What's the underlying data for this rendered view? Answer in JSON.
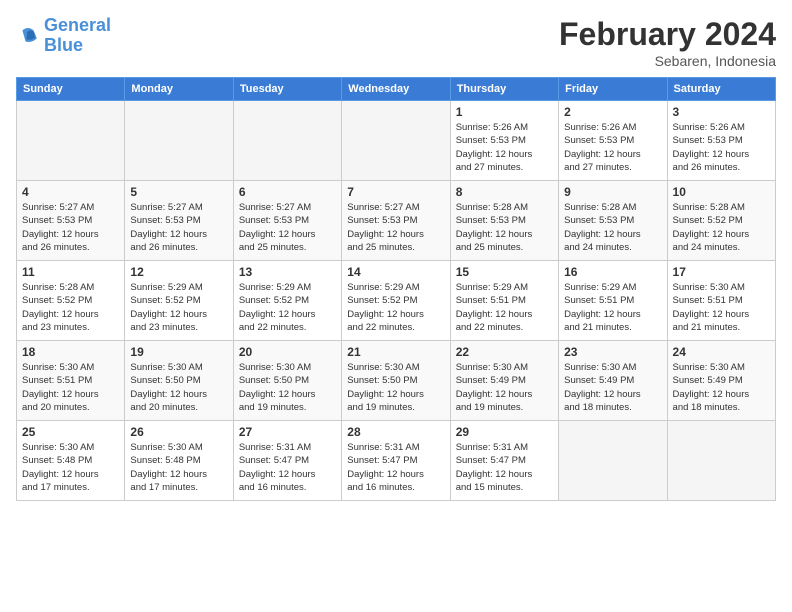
{
  "header": {
    "logo_line1": "General",
    "logo_line2": "Blue",
    "month": "February 2024",
    "location": "Sebaren, Indonesia"
  },
  "weekdays": [
    "Sunday",
    "Monday",
    "Tuesday",
    "Wednesday",
    "Thursday",
    "Friday",
    "Saturday"
  ],
  "weeks": [
    [
      {
        "day": "",
        "info": ""
      },
      {
        "day": "",
        "info": ""
      },
      {
        "day": "",
        "info": ""
      },
      {
        "day": "",
        "info": ""
      },
      {
        "day": "1",
        "info": "Sunrise: 5:26 AM\nSunset: 5:53 PM\nDaylight: 12 hours\nand 27 minutes."
      },
      {
        "day": "2",
        "info": "Sunrise: 5:26 AM\nSunset: 5:53 PM\nDaylight: 12 hours\nand 27 minutes."
      },
      {
        "day": "3",
        "info": "Sunrise: 5:26 AM\nSunset: 5:53 PM\nDaylight: 12 hours\nand 26 minutes."
      }
    ],
    [
      {
        "day": "4",
        "info": "Sunrise: 5:27 AM\nSunset: 5:53 PM\nDaylight: 12 hours\nand 26 minutes."
      },
      {
        "day": "5",
        "info": "Sunrise: 5:27 AM\nSunset: 5:53 PM\nDaylight: 12 hours\nand 26 minutes."
      },
      {
        "day": "6",
        "info": "Sunrise: 5:27 AM\nSunset: 5:53 PM\nDaylight: 12 hours\nand 25 minutes."
      },
      {
        "day": "7",
        "info": "Sunrise: 5:27 AM\nSunset: 5:53 PM\nDaylight: 12 hours\nand 25 minutes."
      },
      {
        "day": "8",
        "info": "Sunrise: 5:28 AM\nSunset: 5:53 PM\nDaylight: 12 hours\nand 25 minutes."
      },
      {
        "day": "9",
        "info": "Sunrise: 5:28 AM\nSunset: 5:53 PM\nDaylight: 12 hours\nand 24 minutes."
      },
      {
        "day": "10",
        "info": "Sunrise: 5:28 AM\nSunset: 5:52 PM\nDaylight: 12 hours\nand 24 minutes."
      }
    ],
    [
      {
        "day": "11",
        "info": "Sunrise: 5:28 AM\nSunset: 5:52 PM\nDaylight: 12 hours\nand 23 minutes."
      },
      {
        "day": "12",
        "info": "Sunrise: 5:29 AM\nSunset: 5:52 PM\nDaylight: 12 hours\nand 23 minutes."
      },
      {
        "day": "13",
        "info": "Sunrise: 5:29 AM\nSunset: 5:52 PM\nDaylight: 12 hours\nand 22 minutes."
      },
      {
        "day": "14",
        "info": "Sunrise: 5:29 AM\nSunset: 5:52 PM\nDaylight: 12 hours\nand 22 minutes."
      },
      {
        "day": "15",
        "info": "Sunrise: 5:29 AM\nSunset: 5:51 PM\nDaylight: 12 hours\nand 22 minutes."
      },
      {
        "day": "16",
        "info": "Sunrise: 5:29 AM\nSunset: 5:51 PM\nDaylight: 12 hours\nand 21 minutes."
      },
      {
        "day": "17",
        "info": "Sunrise: 5:30 AM\nSunset: 5:51 PM\nDaylight: 12 hours\nand 21 minutes."
      }
    ],
    [
      {
        "day": "18",
        "info": "Sunrise: 5:30 AM\nSunset: 5:51 PM\nDaylight: 12 hours\nand 20 minutes."
      },
      {
        "day": "19",
        "info": "Sunrise: 5:30 AM\nSunset: 5:50 PM\nDaylight: 12 hours\nand 20 minutes."
      },
      {
        "day": "20",
        "info": "Sunrise: 5:30 AM\nSunset: 5:50 PM\nDaylight: 12 hours\nand 19 minutes."
      },
      {
        "day": "21",
        "info": "Sunrise: 5:30 AM\nSunset: 5:50 PM\nDaylight: 12 hours\nand 19 minutes."
      },
      {
        "day": "22",
        "info": "Sunrise: 5:30 AM\nSunset: 5:49 PM\nDaylight: 12 hours\nand 19 minutes."
      },
      {
        "day": "23",
        "info": "Sunrise: 5:30 AM\nSunset: 5:49 PM\nDaylight: 12 hours\nand 18 minutes."
      },
      {
        "day": "24",
        "info": "Sunrise: 5:30 AM\nSunset: 5:49 PM\nDaylight: 12 hours\nand 18 minutes."
      }
    ],
    [
      {
        "day": "25",
        "info": "Sunrise: 5:30 AM\nSunset: 5:48 PM\nDaylight: 12 hours\nand 17 minutes."
      },
      {
        "day": "26",
        "info": "Sunrise: 5:30 AM\nSunset: 5:48 PM\nDaylight: 12 hours\nand 17 minutes."
      },
      {
        "day": "27",
        "info": "Sunrise: 5:31 AM\nSunset: 5:47 PM\nDaylight: 12 hours\nand 16 minutes."
      },
      {
        "day": "28",
        "info": "Sunrise: 5:31 AM\nSunset: 5:47 PM\nDaylight: 12 hours\nand 16 minutes."
      },
      {
        "day": "29",
        "info": "Sunrise: 5:31 AM\nSunset: 5:47 PM\nDaylight: 12 hours\nand 15 minutes."
      },
      {
        "day": "",
        "info": ""
      },
      {
        "day": "",
        "info": ""
      }
    ]
  ]
}
